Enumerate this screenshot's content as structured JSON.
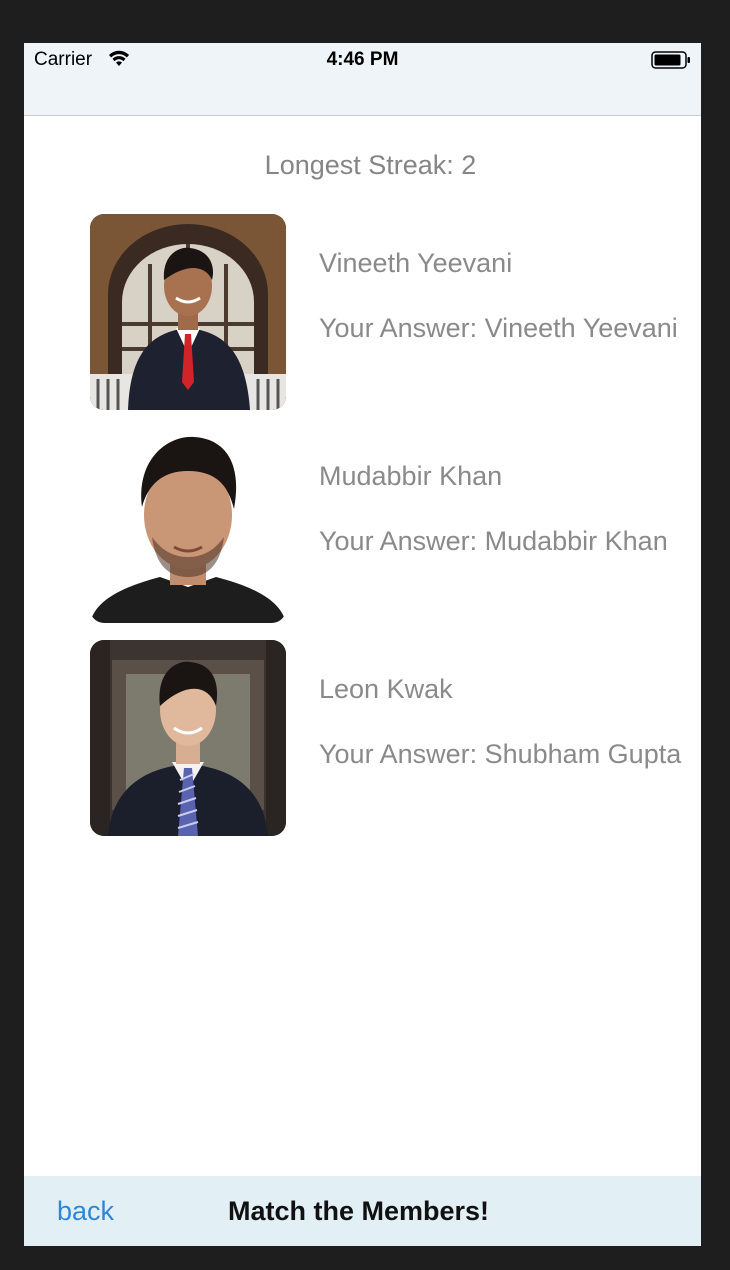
{
  "status_bar": {
    "carrier": "Carrier",
    "wifi_icon": "wifi-icon",
    "time": "4:46 PM",
    "battery_icon": "battery-icon"
  },
  "content": {
    "streak": "Longest Streak: 2",
    "results": [
      {
        "name": "Vineeth Yeevani",
        "answer": "Your Answer: Vineeth Yeevani",
        "photo": "member-photo"
      },
      {
        "name": "Mudabbir Khan",
        "answer": "Your Answer: Mudabbir Khan",
        "photo": "member-photo"
      },
      {
        "name": "Leon Kwak",
        "answer": "Your Answer: Shubham Gupta",
        "photo": "member-photo"
      }
    ]
  },
  "toolbar": {
    "back_label": "back",
    "title": "Match the Members!"
  },
  "colors": {
    "link": "#2f86d6",
    "secondary_text": "#8a8a8a",
    "bar_background": "#e2f0f6"
  }
}
